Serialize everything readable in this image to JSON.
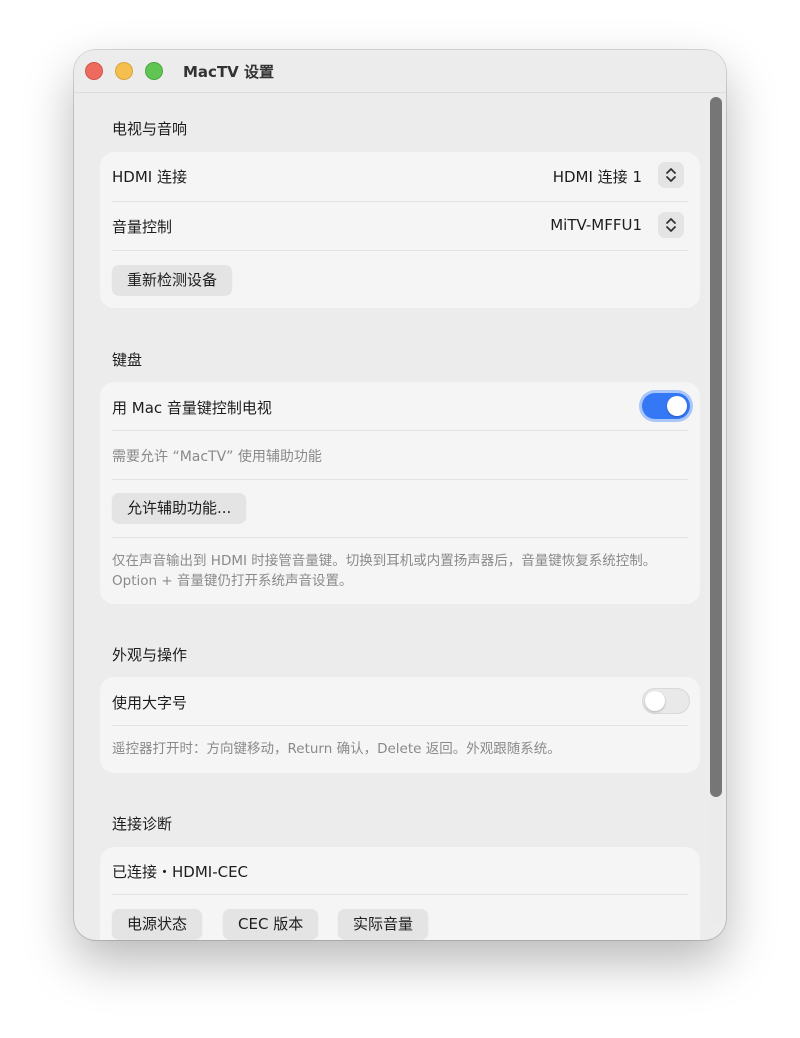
{
  "window": {
    "title": "MacTV 设置"
  },
  "sections": {
    "tv_audio": {
      "title": "电视与音响",
      "hdmi_label": "HDMI 连接",
      "hdmi_value": "HDMI 连接 1",
      "volume_label": "音量控制",
      "volume_value": "MiTV-MFFU1",
      "redetect_button": "重新检测设备"
    },
    "keyboard": {
      "title": "键盘",
      "mac_volume_label": "用 Mac 音量键控制电视",
      "mac_volume_enabled": true,
      "accessibility_notice": "需要允许 “MacTV” 使用辅助功能",
      "allow_button": "允许辅助功能...",
      "note": "仅在声音输出到 HDMI 时接管音量键。切换到耳机或内置扬声器后，音量键恢复系统控制。Option + 音量键仍打开系统声音设置。"
    },
    "appearance": {
      "title": "外观与操作",
      "large_font_label": "使用大字号",
      "large_font_enabled": false,
      "note": "遥控器打开时：方向键移动，Return 确认，Delete 返回。外观跟随系统。"
    },
    "diagnostics": {
      "title": "连接诊断",
      "status": "已连接・HDMI-CEC",
      "buttons": [
        "电源状态",
        "CEC 版本",
        "实际音量"
      ]
    }
  },
  "colors": {
    "accent": "#3478f6",
    "card": "#f5f5f5",
    "window": "#ececec"
  },
  "icons": {
    "popup": "chevron-up-down-icon"
  }
}
